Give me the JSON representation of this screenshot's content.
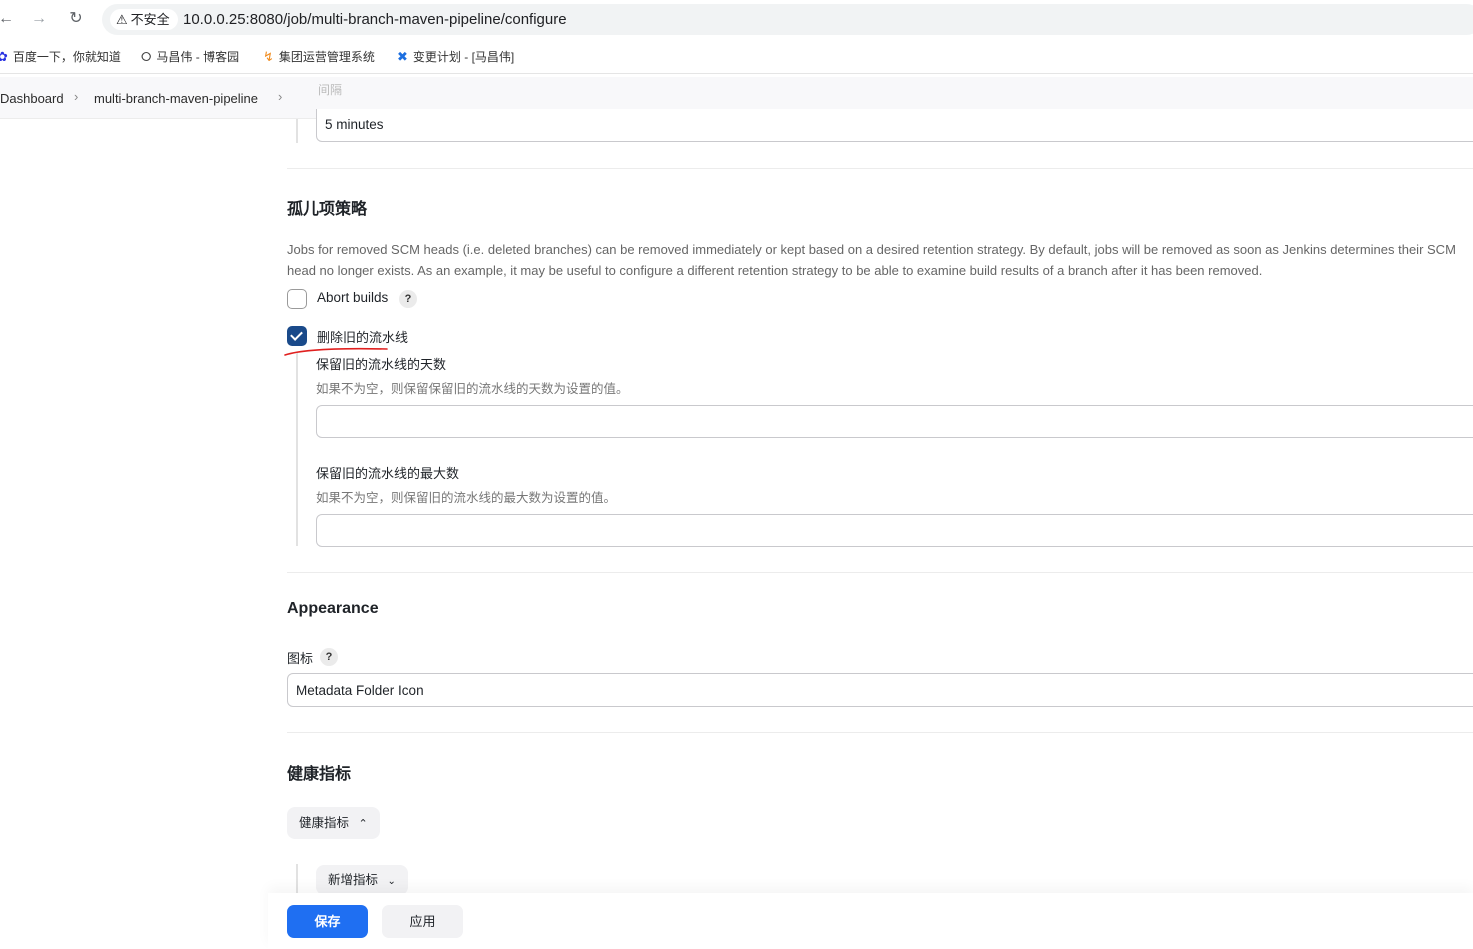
{
  "browser": {
    "security_label": "不安全",
    "url": "10.0.0.25:8080/job/multi-branch-maven-pipeline/configure",
    "bookmarks": [
      {
        "label": "百度一下，你就知道",
        "icon": "baidu-paw-icon"
      },
      {
        "label": "马昌伟 - 博客园",
        "icon": "cnblogs-icon"
      },
      {
        "label": "集团运营管理系统",
        "icon": "orange-spark-icon"
      },
      {
        "label": "变更计划 - [马昌伟]",
        "icon": "confluence-icon"
      }
    ]
  },
  "breadcrumb": {
    "items": [
      "Dashboard",
      "multi-branch-maven-pipeline"
    ]
  },
  "scan": {
    "hidden_label": "间隔",
    "interval_value": "5 minutes"
  },
  "orphan": {
    "heading": "孤儿项策略",
    "description": "Jobs for removed SCM heads (i.e. deleted branches) can be removed immediately or kept based on a desired retention strategy. By default, jobs will be removed as soon as Jenkins determines their SCM head no longer exists. As an example, it may be useful to configure a different retention strategy to be able to examine build results of a branch after it has been removed.",
    "desc_line1": "Jobs for removed SCM heads (i.e. deleted branches) can be removed immediately or kept based on a desired retention strategy. By default, jobs will be removed as soon as Jenkins determines their SCM",
    "desc_line2": "head no longer exists. As an example, it may be useful to configure a different retention strategy to be able to examine build results of a branch after it has been removed.",
    "abort_builds_label": "Abort builds",
    "abort_builds_checked": false,
    "discard_label": "删除旧的流水线",
    "discard_checked": true,
    "days_label": "保留旧的流水线的天数",
    "days_desc": "如果不为空，则保留保留旧的流水线的天数为设置的值。",
    "days_value": "",
    "max_label": "保留旧的流水线的最大数",
    "max_desc": "如果不为空，则保留旧的流水线的最大数为设置的值。",
    "max_value": ""
  },
  "appearance": {
    "heading": "Appearance",
    "icon_label": "图标",
    "icon_value": "Metadata Folder Icon"
  },
  "health": {
    "heading": "健康指标",
    "dropdown_label": "健康指标",
    "add_label": "新增指标"
  },
  "footer": {
    "save_label": "保存",
    "apply_label": "应用"
  },
  "colors": {
    "primary": "#1f6ff2",
    "checkbox_checked": "#1a4a8a",
    "annotation_red": "#e0201f"
  }
}
